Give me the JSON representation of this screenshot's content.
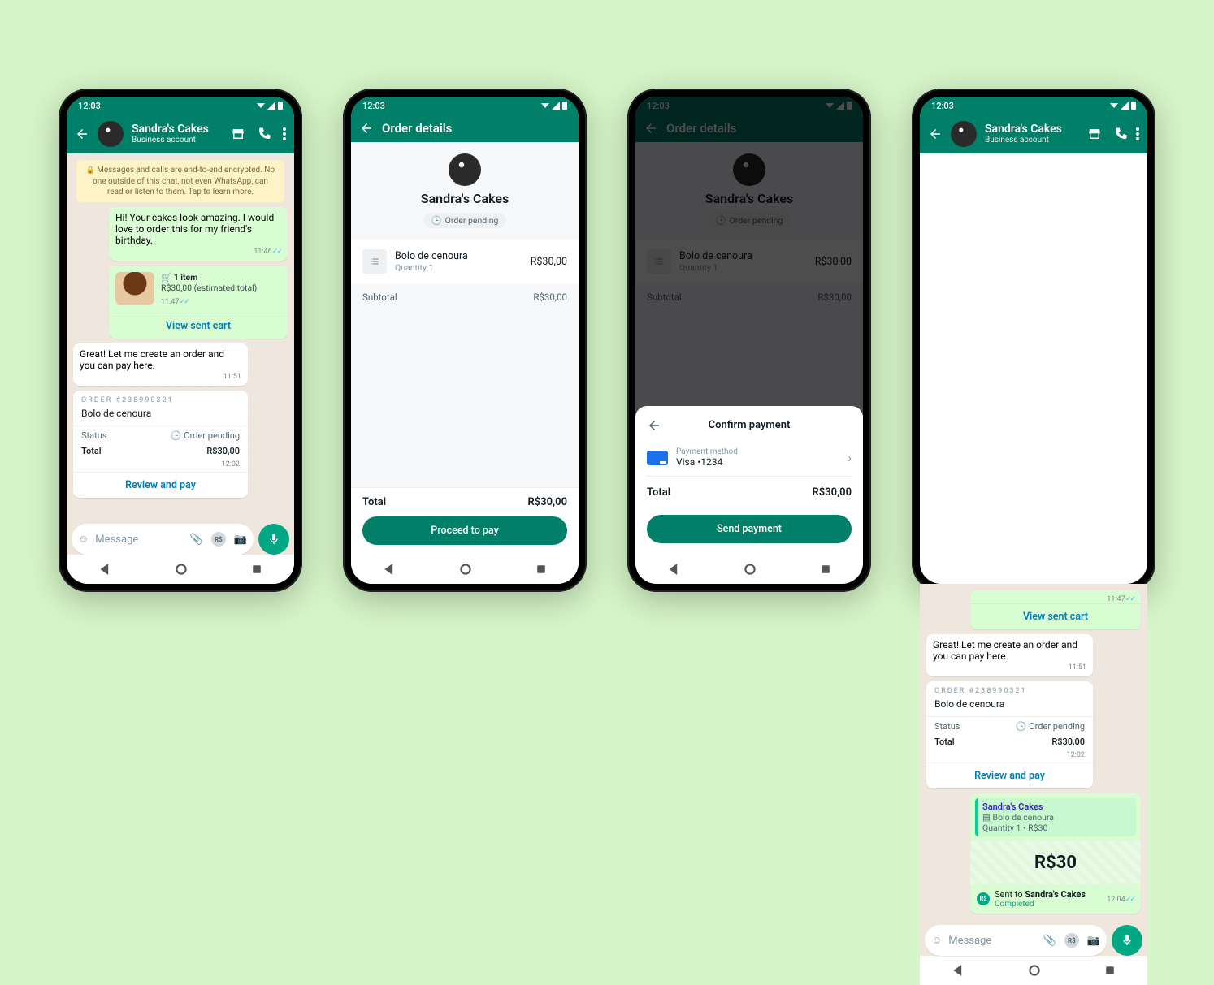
{
  "status_time": "12:03",
  "contact": {
    "name": "Sandra's Cakes",
    "subtitle": "Business account"
  },
  "encryption_notice": "Messages and calls are end-to-end encrypted. No one outside of this chat, not even WhatsApp, can read or listen to them. Tap to learn more.",
  "chat1": {
    "msg1": {
      "text": "Hi! Your cakes look amazing. I would love to order this for my friend's birthday.",
      "time": "11:46"
    },
    "cart": {
      "items_label": "1 item",
      "estimate": "R$30,00 (estimated total)",
      "time": "11:47",
      "link": "View sent cart"
    },
    "reply": {
      "text": "Great! Let me create an order and you can pay here.",
      "time": "11:51"
    },
    "order": {
      "header": "ORDER #238990321",
      "item": "Bolo de cenoura",
      "status_label": "Status",
      "status_value": "Order pending",
      "total_label": "Total",
      "total_value": "R$30,00",
      "time": "12:02",
      "action": "Review and pay"
    },
    "input_placeholder": "Message"
  },
  "details": {
    "title": "Order details",
    "merchant": "Sandra's Cakes",
    "pending": "Order pending",
    "item_name": "Bolo de cenoura",
    "item_qty": "Quantity 1",
    "item_price": "R$30,00",
    "subtotal_label": "Subtotal",
    "subtotal_value": "R$30,00",
    "total_label": "Total",
    "total_value": "R$30,00",
    "proceed": "Proceed to pay"
  },
  "confirm": {
    "title": "Confirm payment",
    "pm_label": "Payment method",
    "pm_value": "Visa •1234",
    "total_label": "Total",
    "total_value": "R$30,00",
    "send": "Send payment"
  },
  "chat4": {
    "cart_time": "11:47",
    "cart_link": "View sent cart",
    "reply": {
      "text": "Great! Let me create an order and you can pay here.",
      "time": "11:51"
    },
    "order": {
      "header": "ORDER #238990321",
      "item": "Bolo de cenoura",
      "status_label": "Status",
      "status_value": "Order pending",
      "total_label": "Total",
      "total_value": "R$30,00",
      "time": "12:02",
      "action": "Review and pay"
    },
    "payment": {
      "quote_name": "Sandra's Cakes",
      "quote_line1": "Bolo de cenoura",
      "quote_line2": "Quantity 1 • R$30",
      "amount": "R$30",
      "sent_prefix": "Sent to ",
      "sent_to": "Sandra's Cakes",
      "completed": "Completed",
      "time": "12:04"
    },
    "input_placeholder": "Message"
  }
}
